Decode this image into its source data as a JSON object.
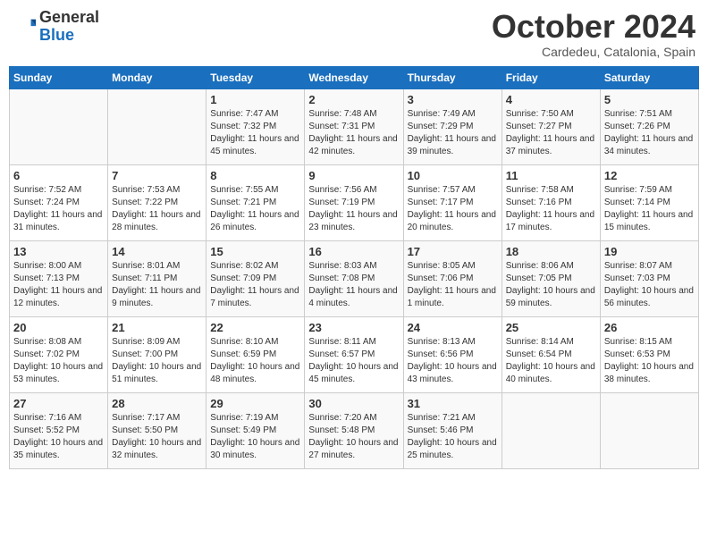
{
  "header": {
    "logo_general": "General",
    "logo_blue": "Blue",
    "month_title": "October 2024",
    "location": "Cardedeu, Catalonia, Spain"
  },
  "weekdays": [
    "Sunday",
    "Monday",
    "Tuesday",
    "Wednesday",
    "Thursday",
    "Friday",
    "Saturday"
  ],
  "weeks": [
    [
      {
        "day": "",
        "info": ""
      },
      {
        "day": "",
        "info": ""
      },
      {
        "day": "1",
        "info": "Sunrise: 7:47 AM\nSunset: 7:32 PM\nDaylight: 11 hours and 45 minutes."
      },
      {
        "day": "2",
        "info": "Sunrise: 7:48 AM\nSunset: 7:31 PM\nDaylight: 11 hours and 42 minutes."
      },
      {
        "day": "3",
        "info": "Sunrise: 7:49 AM\nSunset: 7:29 PM\nDaylight: 11 hours and 39 minutes."
      },
      {
        "day": "4",
        "info": "Sunrise: 7:50 AM\nSunset: 7:27 PM\nDaylight: 11 hours and 37 minutes."
      },
      {
        "day": "5",
        "info": "Sunrise: 7:51 AM\nSunset: 7:26 PM\nDaylight: 11 hours and 34 minutes."
      }
    ],
    [
      {
        "day": "6",
        "info": "Sunrise: 7:52 AM\nSunset: 7:24 PM\nDaylight: 11 hours and 31 minutes."
      },
      {
        "day": "7",
        "info": "Sunrise: 7:53 AM\nSunset: 7:22 PM\nDaylight: 11 hours and 28 minutes."
      },
      {
        "day": "8",
        "info": "Sunrise: 7:55 AM\nSunset: 7:21 PM\nDaylight: 11 hours and 26 minutes."
      },
      {
        "day": "9",
        "info": "Sunrise: 7:56 AM\nSunset: 7:19 PM\nDaylight: 11 hours and 23 minutes."
      },
      {
        "day": "10",
        "info": "Sunrise: 7:57 AM\nSunset: 7:17 PM\nDaylight: 11 hours and 20 minutes."
      },
      {
        "day": "11",
        "info": "Sunrise: 7:58 AM\nSunset: 7:16 PM\nDaylight: 11 hours and 17 minutes."
      },
      {
        "day": "12",
        "info": "Sunrise: 7:59 AM\nSunset: 7:14 PM\nDaylight: 11 hours and 15 minutes."
      }
    ],
    [
      {
        "day": "13",
        "info": "Sunrise: 8:00 AM\nSunset: 7:13 PM\nDaylight: 11 hours and 12 minutes."
      },
      {
        "day": "14",
        "info": "Sunrise: 8:01 AM\nSunset: 7:11 PM\nDaylight: 11 hours and 9 minutes."
      },
      {
        "day": "15",
        "info": "Sunrise: 8:02 AM\nSunset: 7:09 PM\nDaylight: 11 hours and 7 minutes."
      },
      {
        "day": "16",
        "info": "Sunrise: 8:03 AM\nSunset: 7:08 PM\nDaylight: 11 hours and 4 minutes."
      },
      {
        "day": "17",
        "info": "Sunrise: 8:05 AM\nSunset: 7:06 PM\nDaylight: 11 hours and 1 minute."
      },
      {
        "day": "18",
        "info": "Sunrise: 8:06 AM\nSunset: 7:05 PM\nDaylight: 10 hours and 59 minutes."
      },
      {
        "day": "19",
        "info": "Sunrise: 8:07 AM\nSunset: 7:03 PM\nDaylight: 10 hours and 56 minutes."
      }
    ],
    [
      {
        "day": "20",
        "info": "Sunrise: 8:08 AM\nSunset: 7:02 PM\nDaylight: 10 hours and 53 minutes."
      },
      {
        "day": "21",
        "info": "Sunrise: 8:09 AM\nSunset: 7:00 PM\nDaylight: 10 hours and 51 minutes."
      },
      {
        "day": "22",
        "info": "Sunrise: 8:10 AM\nSunset: 6:59 PM\nDaylight: 10 hours and 48 minutes."
      },
      {
        "day": "23",
        "info": "Sunrise: 8:11 AM\nSunset: 6:57 PM\nDaylight: 10 hours and 45 minutes."
      },
      {
        "day": "24",
        "info": "Sunrise: 8:13 AM\nSunset: 6:56 PM\nDaylight: 10 hours and 43 minutes."
      },
      {
        "day": "25",
        "info": "Sunrise: 8:14 AM\nSunset: 6:54 PM\nDaylight: 10 hours and 40 minutes."
      },
      {
        "day": "26",
        "info": "Sunrise: 8:15 AM\nSunset: 6:53 PM\nDaylight: 10 hours and 38 minutes."
      }
    ],
    [
      {
        "day": "27",
        "info": "Sunrise: 7:16 AM\nSunset: 5:52 PM\nDaylight: 10 hours and 35 minutes."
      },
      {
        "day": "28",
        "info": "Sunrise: 7:17 AM\nSunset: 5:50 PM\nDaylight: 10 hours and 32 minutes."
      },
      {
        "day": "29",
        "info": "Sunrise: 7:19 AM\nSunset: 5:49 PM\nDaylight: 10 hours and 30 minutes."
      },
      {
        "day": "30",
        "info": "Sunrise: 7:20 AM\nSunset: 5:48 PM\nDaylight: 10 hours and 27 minutes."
      },
      {
        "day": "31",
        "info": "Sunrise: 7:21 AM\nSunset: 5:46 PM\nDaylight: 10 hours and 25 minutes."
      },
      {
        "day": "",
        "info": ""
      },
      {
        "day": "",
        "info": ""
      }
    ]
  ]
}
